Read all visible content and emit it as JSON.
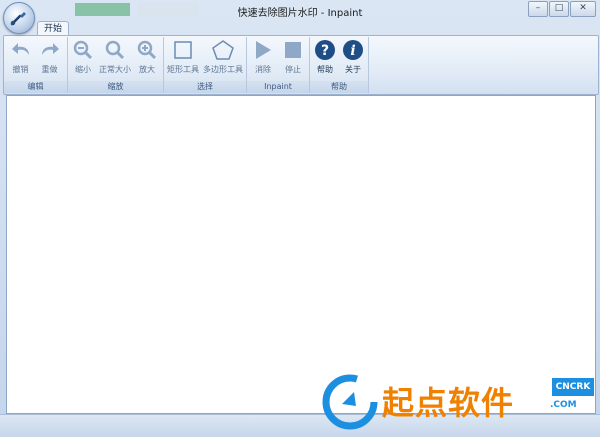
{
  "window": {
    "title": "快速去除图片水印 - Inpaint",
    "controls": {
      "minimize": "–",
      "maximize": "□",
      "close": "✕"
    }
  },
  "tabs": [
    {
      "label": "开始",
      "active": true
    }
  ],
  "ribbon": {
    "groups": [
      {
        "label": "编辑",
        "buttons": [
          {
            "label": "撤销",
            "icon": "undo-icon"
          },
          {
            "label": "重做",
            "icon": "redo-icon"
          }
        ]
      },
      {
        "label": "缩放",
        "buttons": [
          {
            "label": "缩小",
            "icon": "zoom-out-icon"
          },
          {
            "label": "正常大小",
            "icon": "zoom-normal-icon"
          },
          {
            "label": "放大",
            "icon": "zoom-in-icon"
          }
        ]
      },
      {
        "label": "选择",
        "buttons": [
          {
            "label": "矩形工具",
            "icon": "rectangle-icon"
          },
          {
            "label": "多边形工具",
            "icon": "polygon-icon"
          }
        ]
      },
      {
        "label": "Inpaint",
        "buttons": [
          {
            "label": "消除",
            "icon": "play-icon"
          },
          {
            "label": "停止",
            "icon": "stop-icon"
          }
        ]
      },
      {
        "label": "帮助",
        "buttons": [
          {
            "label": "帮助",
            "icon": "help-icon"
          },
          {
            "label": "关于",
            "icon": "info-icon"
          }
        ]
      }
    ]
  },
  "watermark": {
    "text": "起点软件",
    "en": "CNCRK",
    "com": ".COM"
  },
  "colors": {
    "accent": "#1d8fe0",
    "ribbon_icon_disabled": "#8fa8c8",
    "ribbon_icon_active": "#1f4d86"
  }
}
